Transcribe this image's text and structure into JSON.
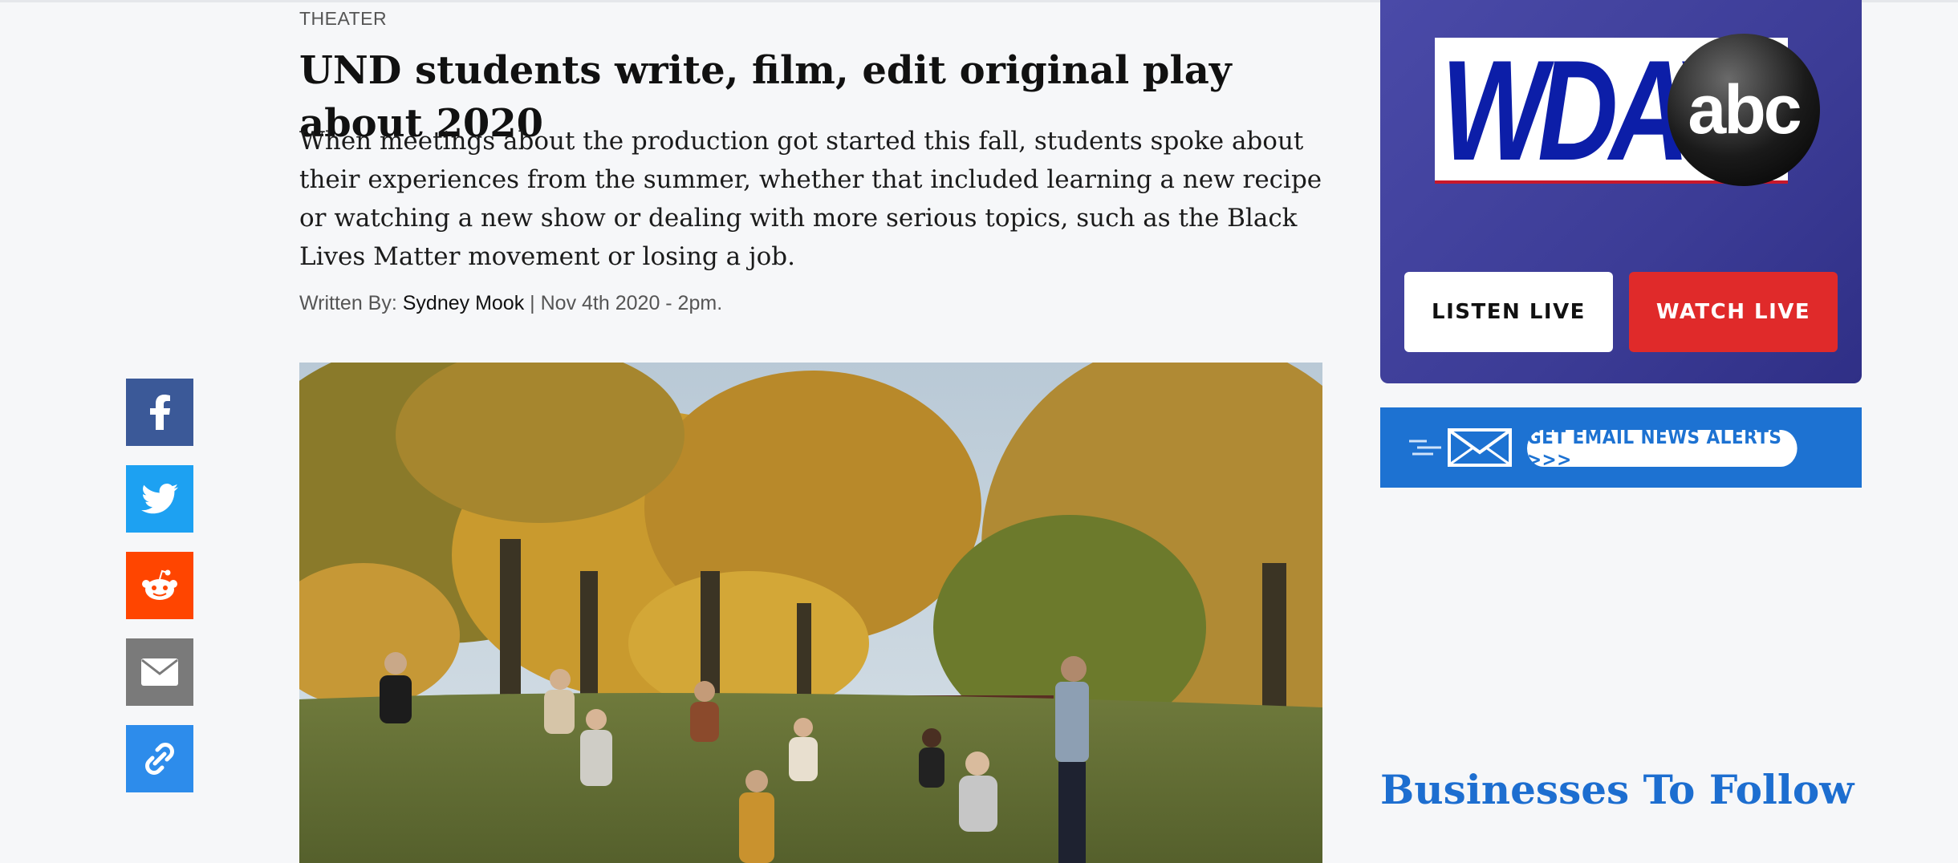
{
  "article": {
    "category": "THEATER",
    "headline": "UND students write, film, edit original play about 2020",
    "dek": "When meetings about the production got started this fall, students spoke about their experiences from the summer, whether that included learning a new recipe or watching a new show or dealing with more serious topics, such as the Black Lives Matter movement or losing a job.",
    "byline": {
      "prefix": "Written By:",
      "author": "Sydney Mook",
      "separator": "|",
      "date": "Nov 4th 2020 - 2pm."
    }
  },
  "share": [
    {
      "icon": "facebook-icon",
      "color": "#3b5998"
    },
    {
      "icon": "twitter-icon",
      "color": "#1da1f2"
    },
    {
      "icon": "reddit-icon",
      "color": "#ff4500"
    },
    {
      "icon": "email-icon",
      "color": "#7a7a7a"
    },
    {
      "icon": "link-icon",
      "color": "#2d8ceb"
    }
  ],
  "sidebar": {
    "station_logo_text": "WDAY",
    "network_logo_text": "abc",
    "listen_live": "LISTEN LIVE",
    "watch_live": "WATCH LIVE",
    "email_alerts": "GET EMAIL NEWS ALERTS >>>",
    "section_title": "Businesses To Follow"
  },
  "colors": {
    "accent_blue": "#1d72d2",
    "station_purple": "#3c3c96",
    "watch_red": "#e02a2a"
  }
}
